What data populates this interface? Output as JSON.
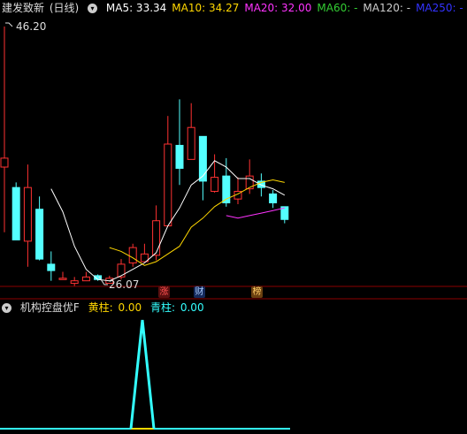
{
  "stock": {
    "name": "建发致新",
    "period": "(日线)"
  },
  "ma_legend": [
    {
      "label": "MA5:",
      "value": "33.34",
      "color": "#ffffff"
    },
    {
      "label": "MA10:",
      "value": "34.27",
      "color": "#ffd700"
    },
    {
      "label": "MA20:",
      "value": "32.00",
      "color": "#ff33ff"
    },
    {
      "label": "MA60:",
      "value": "-",
      "color": "#33cc33"
    },
    {
      "label": "MA120:",
      "value": "-",
      "color": "#cccccc"
    },
    {
      "label": "MA250:",
      "value": "-",
      "color": "#3333ff"
    }
  ],
  "price_annotations": {
    "high": "46.20",
    "low": "26.07"
  },
  "badges": {
    "zhang": "涨",
    "cai": "财",
    "bang": "榜"
  },
  "indicator": {
    "name": "机构控盘优F",
    "yellow_label": "黄柱:",
    "yellow_value": "0.00",
    "cyan_label": "青柱:",
    "cyan_value": "0.00"
  },
  "colors": {
    "up": "#ff3232",
    "down": "#54ffff",
    "ma5": "#ffffff",
    "ma10": "#ffd700",
    "ma20": "#ff33ff",
    "grid": "#8b0000"
  },
  "chart_data": {
    "type": "candlestick",
    "candles": [
      {
        "o": 35.2,
        "c": 35.9,
        "h": 46.2,
        "l": 30.1
      },
      {
        "o": 33.6,
        "c": 29.5,
        "h": 34.0,
        "l": 29.5
      },
      {
        "o": 29.4,
        "c": 33.6,
        "h": 35.4,
        "l": 27.4
      },
      {
        "o": 31.9,
        "c": 28.0,
        "h": 32.9,
        "l": 27.9
      },
      {
        "o": 27.6,
        "c": 27.1,
        "h": 28.6,
        "l": 26.3
      },
      {
        "o": 26.5,
        "c": 26.5,
        "h": 27.0,
        "l": 26.4
      },
      {
        "o": 26.1,
        "c": 26.3,
        "h": 26.6,
        "l": 25.9
      },
      {
        "o": 26.3,
        "c": 26.6,
        "h": 27.0,
        "l": 26.3
      },
      {
        "o": 26.7,
        "c": 26.4,
        "h": 26.8,
        "l": 26.3
      },
      {
        "o": 26.1,
        "c": 26.5,
        "h": 26.7,
        "l": 26.07
      },
      {
        "o": 26.6,
        "c": 27.6,
        "h": 28.0,
        "l": 26.4
      },
      {
        "o": 27.7,
        "c": 28.9,
        "h": 29.2,
        "l": 27.4
      },
      {
        "o": 27.8,
        "c": 28.4,
        "h": 29.2,
        "l": 27.8
      },
      {
        "o": 28.3,
        "c": 31.0,
        "h": 32.2,
        "l": 27.9
      },
      {
        "o": 30.6,
        "c": 37.0,
        "h": 39.2,
        "l": 30.6
      },
      {
        "o": 36.9,
        "c": 35.1,
        "h": 40.5,
        "l": 33.8
      },
      {
        "o": 35.8,
        "c": 38.3,
        "h": 40.2,
        "l": 35.8
      },
      {
        "o": 37.6,
        "c": 34.1,
        "h": 37.6,
        "l": 32.6
      },
      {
        "o": 33.3,
        "c": 34.4,
        "h": 36.2,
        "l": 33.2
      },
      {
        "o": 34.5,
        "c": 32.4,
        "h": 35.9,
        "l": 32.1
      },
      {
        "o": 32.7,
        "c": 33.3,
        "h": 34.4,
        "l": 32.3
      },
      {
        "o": 33.5,
        "c": 34.5,
        "h": 35.8,
        "l": 33.1
      },
      {
        "o": 34.1,
        "c": 33.6,
        "h": 34.7,
        "l": 32.9
      },
      {
        "o": 33.1,
        "c": 32.4,
        "h": 33.4,
        "l": 32.0
      },
      {
        "o": 32.1,
        "c": 31.1,
        "h": 32.1,
        "l": 30.8
      }
    ],
    "ma5": [
      null,
      null,
      null,
      null,
      33.5,
      31.7,
      29.0,
      27.2,
      26.4,
      26.3,
      26.7,
      27.2,
      27.7,
      28.5,
      30.6,
      32.0,
      33.8,
      34.5,
      35.7,
      35.2,
      34.3,
      34.3,
      33.8,
      33.5,
      33.0
    ],
    "ma10": [
      null,
      null,
      null,
      null,
      null,
      null,
      null,
      null,
      null,
      28.9,
      28.6,
      28.1,
      27.5,
      27.8,
      28.4,
      29.0,
      30.5,
      31.2,
      32.1,
      32.7,
      33.1,
      33.6,
      34.0,
      34.2,
      34.0
    ],
    "ma20": [
      null,
      null,
      null,
      null,
      null,
      null,
      null,
      null,
      null,
      null,
      null,
      null,
      null,
      null,
      null,
      null,
      null,
      null,
      null,
      31.4,
      31.2,
      31.4,
      31.6,
      31.8,
      32.0
    ],
    "indicator_peak_index": 13
  }
}
